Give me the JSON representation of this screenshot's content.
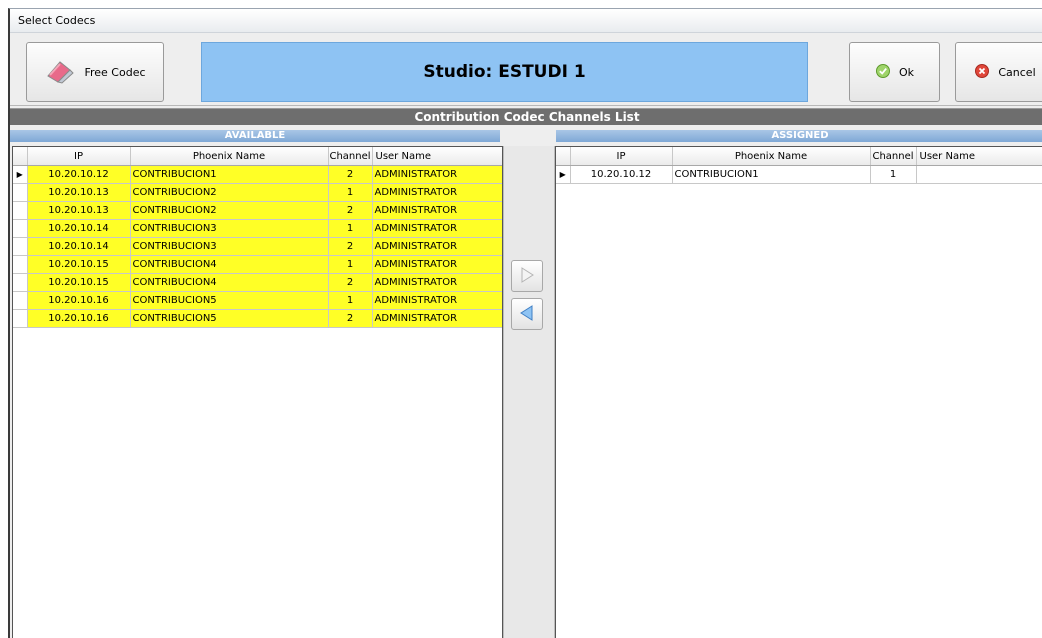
{
  "window": {
    "title": "Select Codecs"
  },
  "toolbar": {
    "free_codec_label": "Free Codec",
    "studio_title": "Studio: ESTUDI 1",
    "ok_label": "Ok",
    "cancel_label": "Cancel"
  },
  "list_title": "Contribution Codec Channels List",
  "available": {
    "header": "AVAILABLE",
    "columns": [
      "IP",
      "Phoenix Name",
      "Channel",
      "User Name"
    ],
    "rows": [
      {
        "ip": "10.20.10.12",
        "name": "CONTRIBUCION1",
        "channel": "2",
        "user": "ADMINISTRATOR"
      },
      {
        "ip": "10.20.10.13",
        "name": "CONTRIBUCION2",
        "channel": "1",
        "user": "ADMINISTRATOR"
      },
      {
        "ip": "10.20.10.13",
        "name": "CONTRIBUCION2",
        "channel": "2",
        "user": "ADMINISTRATOR"
      },
      {
        "ip": "10.20.10.14",
        "name": "CONTRIBUCION3",
        "channel": "1",
        "user": "ADMINISTRATOR"
      },
      {
        "ip": "10.20.10.14",
        "name": "CONTRIBUCION3",
        "channel": "2",
        "user": "ADMINISTRATOR"
      },
      {
        "ip": "10.20.10.15",
        "name": "CONTRIBUCION4",
        "channel": "1",
        "user": "ADMINISTRATOR"
      },
      {
        "ip": "10.20.10.15",
        "name": "CONTRIBUCION4",
        "channel": "2",
        "user": "ADMINISTRATOR"
      },
      {
        "ip": "10.20.10.16",
        "name": "CONTRIBUCION5",
        "channel": "1",
        "user": "ADMINISTRATOR"
      },
      {
        "ip": "10.20.10.16",
        "name": "CONTRIBUCION5",
        "channel": "2",
        "user": "ADMINISTRATOR"
      }
    ]
  },
  "assigned": {
    "header": "ASSIGNED",
    "columns": [
      "IP",
      "Phoenix Name",
      "Channel",
      "User Name"
    ],
    "rows": [
      {
        "ip": "10.20.10.12",
        "name": "CONTRIBUCION1",
        "channel": "1",
        "user": ""
      }
    ]
  },
  "icons": {
    "free_codec": "eraser-icon",
    "ok": "check-circle-icon",
    "cancel": "x-circle-icon",
    "move_right": "arrow-right-icon",
    "move_left": "arrow-left-icon",
    "row_selector": "row-pointer-icon"
  },
  "colors": {
    "available_row": "#ffff26",
    "studio_banner": "#8ec3f3",
    "section_header": "#7fa8d6",
    "list_header": "#6e6e6e"
  }
}
